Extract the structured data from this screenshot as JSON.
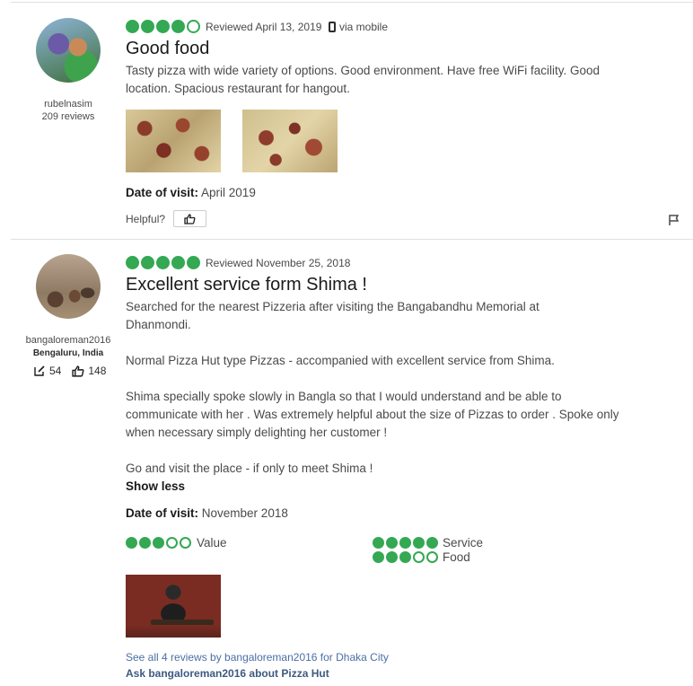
{
  "reviews": [
    {
      "user": {
        "name": "rubelnasim",
        "reviews": "209 reviews"
      },
      "rating": 4,
      "reviewed": "Reviewed April 13, 2019",
      "via": "via mobile",
      "title": "Good food",
      "body": "Tasty pizza with wide variety of options. Good environment. Have free WiFi facility. Good location. Spacious restaurant for hangout.",
      "photos": [
        "pizza-photo-1",
        "pizza-photo-2"
      ],
      "date_label": "Date of visit:",
      "date_value": "April 2019",
      "helpful": "Helpful?"
    },
    {
      "user": {
        "name": "bangaloreman2016",
        "location": "Bengaluru, India",
        "contributions": "54",
        "helpful_votes": "148"
      },
      "rating": 5,
      "reviewed": "Reviewed November 25, 2018",
      "title": "Excellent service form Shima !",
      "p1": "Searched for the nearest Pizzeria after visiting the Bangabandhu Memorial at Dhanmondi.",
      "p2": "Normal Pizza Hut type Pizzas - accompanied with excellent service from Shima.",
      "p3": "Shima specially spoke slowly in Bangla so that I would understand and be able to communicate with her . Was extremely helpful about the size of Pizzas to order . Spoke only when necessary simply delighting her customer !",
      "p4": "Go and visit the place - if only to meet Shima !",
      "show_less": "Show less",
      "date_label": "Date of visit:",
      "date_value": "November 2018",
      "subratings": [
        {
          "label": "Value",
          "rating": 3
        },
        {
          "label": "Service",
          "rating": 5
        },
        {
          "label": "Food",
          "rating": 3
        }
      ],
      "see_all": "See all 4 reviews by bangaloreman2016 for Dhaka City",
      "ask": "Ask bangaloreman2016 about Pizza Hut"
    }
  ],
  "colors": {
    "bubble": "#34a853",
    "link": "#4a6fa5"
  }
}
